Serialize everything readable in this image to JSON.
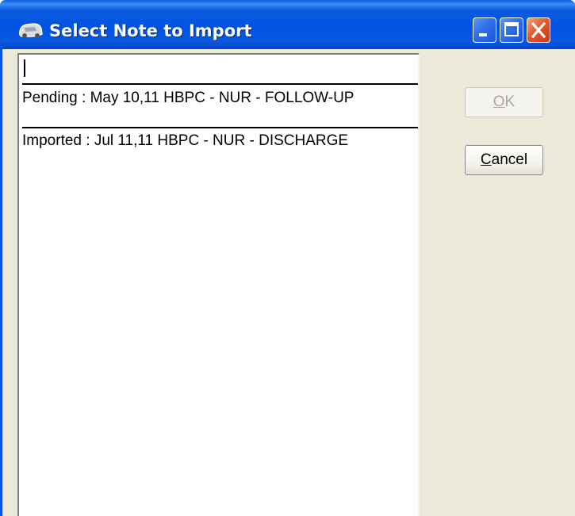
{
  "window": {
    "title": "Select Note to Import",
    "icon": "app-icon",
    "controls": [
      "minimize-icon",
      "maximize-icon",
      "close-icon"
    ],
    "colors": {
      "titlebar": "#0054e3",
      "client": "#ece9d8",
      "close": "#e35a2f"
    }
  },
  "input": {
    "value": ""
  },
  "notes": [
    {
      "label": "Pending : May 10,11 HBPC - NUR - FOLLOW-UP"
    },
    {
      "label": "Imported : Jul 11,11 HBPC - NUR - DISCHARGE"
    }
  ],
  "buttons": {
    "ok": {
      "accel": "O",
      "rest": "K",
      "enabled": false
    },
    "cancel": {
      "accel": "C",
      "rest": "ancel",
      "enabled": true
    }
  }
}
